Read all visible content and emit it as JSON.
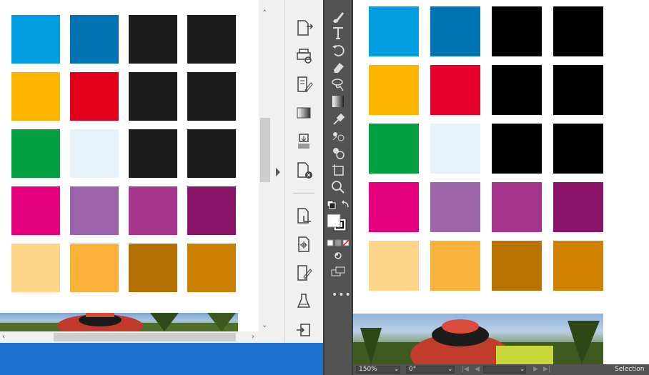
{
  "colors": {
    "left_swatch_rows": [
      [
        "#009ee0",
        "#0072b2",
        "#1c1c1c",
        "#1c1c1c"
      ],
      [
        "#fcb600",
        "#e3001b",
        "#1c1c1c",
        "#1c1c1c"
      ],
      [
        "#00a040",
        "#e6f3fd",
        "#1c1c1c",
        "#1c1c1c"
      ],
      [
        "#e4007e",
        "#9b64aa",
        "#a5358d",
        "#891468"
      ],
      [
        "#fdd589",
        "#f9b13a",
        "#b67200",
        "#cd7f00"
      ]
    ],
    "right_swatch_rows": [
      [
        "#009ee0",
        "#0073b3",
        "#000000",
        "#000000"
      ],
      [
        "#fcb600",
        "#e4002b",
        "#000000",
        "#000000"
      ],
      [
        "#00a040",
        "#e6f3fd",
        "#000000",
        "#000000"
      ],
      [
        "#e4007e",
        "#9d64aa",
        "#a4358d",
        "#8a1469"
      ],
      [
        "#fdd589",
        "#f8b23b",
        "#b97200",
        "#d08100"
      ]
    ]
  },
  "dock_icons": [
    "export-document-icon",
    "print-preview-icon",
    "edit-document-icon",
    "gradient-icon",
    "pattern-icon",
    "document-close-icon",
    "crop-page-icon",
    "place-file-icon",
    "document-pen-icon",
    "flask-icon",
    "swap-page-icon"
  ],
  "tools": [
    "brush-icon",
    "type-icon",
    "rotate-icon",
    "eraser-icon",
    "lasso-icon",
    "gradient-swatch-icon",
    "eyedropper-icon",
    "blend-icon",
    "shape-builder-icon",
    "artboard-icon",
    "zoom-icon"
  ],
  "status": {
    "zoom": "150%",
    "rotation": "0°",
    "mode": "Selection"
  }
}
